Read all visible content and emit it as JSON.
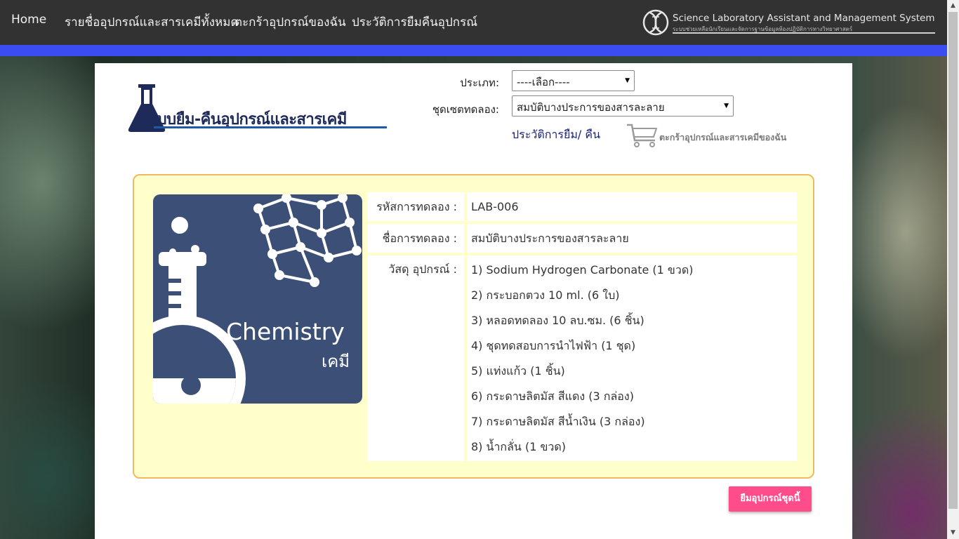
{
  "nav": {
    "items": [
      "Home",
      "รายชื่ออุปกรณ์และสารเคมีทั้งหมด",
      "ตะกร้าอุปกรณ์ของฉัน",
      "ประวัติการยืมคืนอุปกรณ์"
    ],
    "brand_title": "Science Laboratory Assistant and Management System",
    "brand_subtitle": "ระบบช่วยเหลือนักเรียนและจัดการฐานข้อมูลห้องปฏิบัติการทางวิทยาศาสตร์",
    "bar_color": "#323232",
    "strip_color": "#3b4cf0"
  },
  "header": {
    "logo_text": "ระบบยืม-คืนอุปกรณ์และสารเคมี",
    "type_label": "ประเภท:",
    "type_value": "----เลือก----",
    "set_label": "ชุดเซตทดลอง:",
    "set_value": "สมบัติบางประการของสารละลาย",
    "history_link": "ประวัติการยืม/ คืน",
    "cart_label": "ตะกร้าอุปกรณ์และสารเคมีของฉัน"
  },
  "experiment": {
    "image_text": "Chemistry",
    "image_text_thai": "เคมี",
    "code_label": "รหัสการทดลอง :",
    "code_value": "LAB-006",
    "name_label": "ชื่อการทดลอง :",
    "name_value": "สมบัติบางประการของสารละลาย",
    "materials_label": "วัสดุ อุปกรณ์ :",
    "materials": [
      "1) Sodium Hydrogen Carbonate (1 ขวด)",
      "2) กระบอกตวง 10 ml. (6 ใบ)",
      "3) หลอดทดลอง 10 ลบ.ซม. (6 ชิ้น)",
      "4) ชุดทดสอบการนำไฟฟ้า (1 ชุด)",
      "5) แท่งแก้ว (1 ชิ้น)",
      "6) กระดาษลิตมัส สีแดง (3 กล่อง)",
      "7) กระดาษลิตมัส สีน้ำเงิน (3 กล่อง)",
      "8) น้ำกลั่น (1 ขวด)"
    ]
  },
  "actions": {
    "borrow_label": "ยืมอุปกรณ์ชุดนี้",
    "borrow_color": "#ff4c8b"
  }
}
